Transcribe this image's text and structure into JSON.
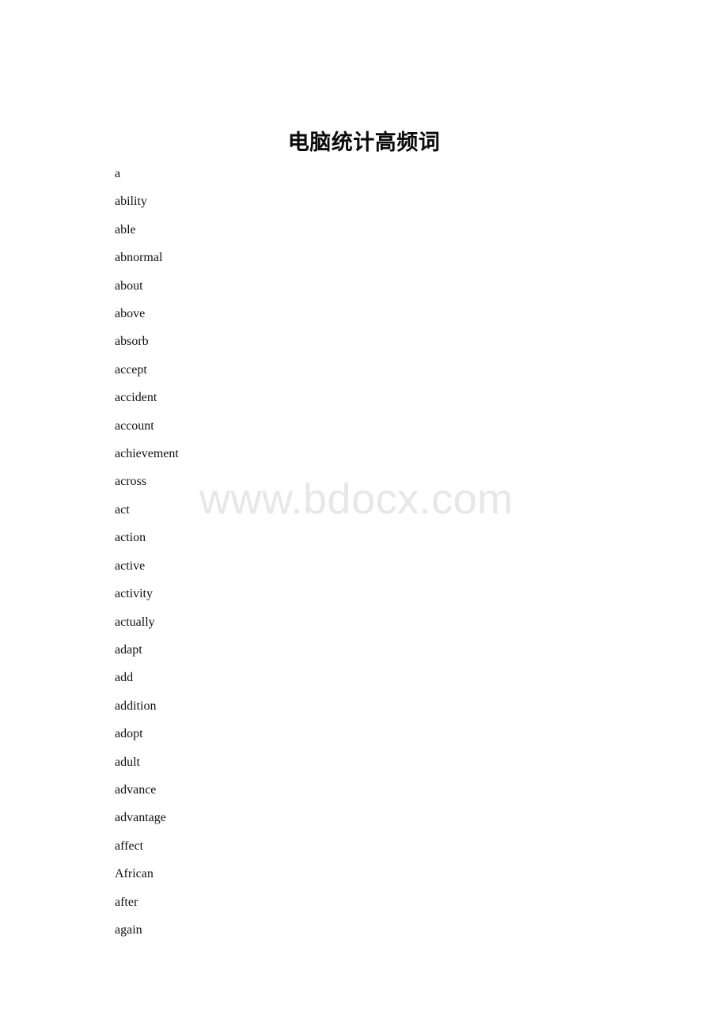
{
  "document": {
    "title": "电脑统计高频词",
    "watermark": "www.bdocx.com",
    "words": [
      "a",
      "ability",
      "able",
      "abnormal",
      "about",
      "above",
      "absorb",
      "accept",
      "accident",
      "account",
      "achievement",
      "across",
      "act",
      "action",
      "active",
      "activity",
      "actually",
      "adapt",
      "add",
      "addition",
      "adopt",
      "adult",
      "advance",
      "advantage",
      "affect",
      "African",
      "after",
      "again"
    ]
  },
  "colors": {
    "page_background": "#ffffff",
    "text": "#111111",
    "title": "#0a0a0a",
    "watermark": "#e7e7e7"
  }
}
